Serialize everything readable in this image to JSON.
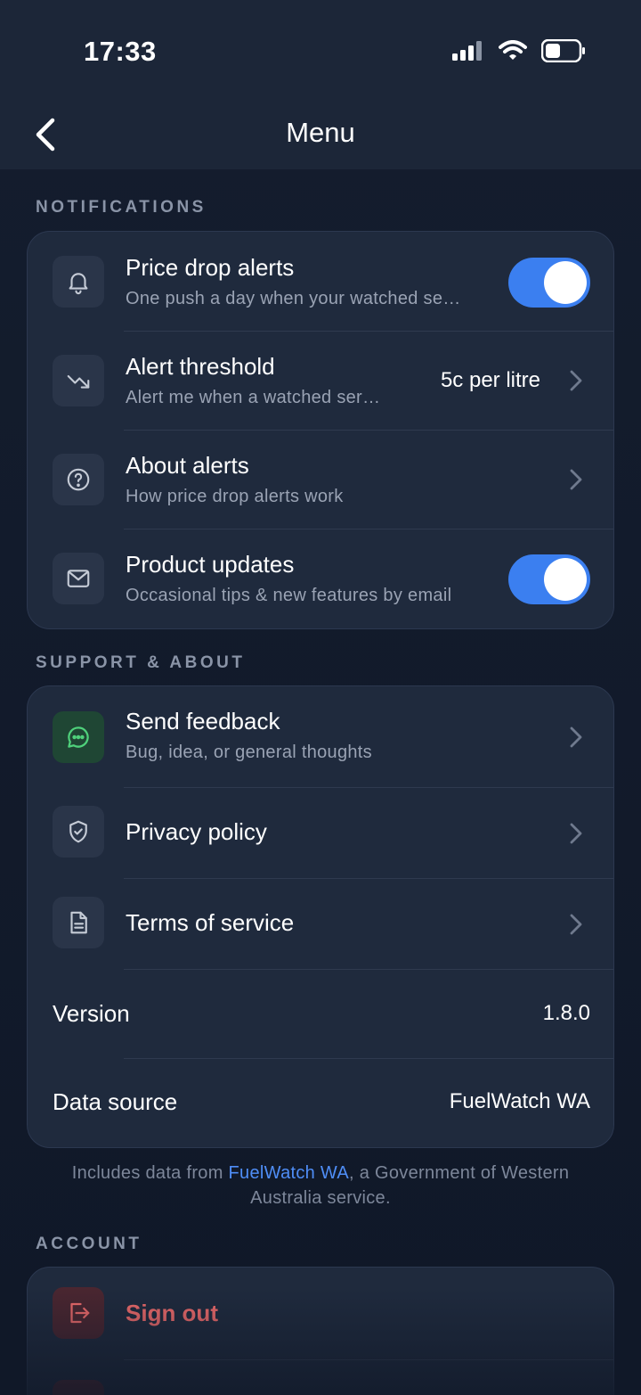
{
  "status_bar": {
    "time": "17:33"
  },
  "nav": {
    "title": "Menu"
  },
  "sections": {
    "notifications": {
      "label": "NOTIFICATIONS",
      "rows": [
        {
          "title": "Price drop alerts",
          "subtitle": "One push a day when your watched se…",
          "toggle": true
        },
        {
          "title": "Alert threshold",
          "subtitle": "Alert me when a watched ser…",
          "value": "5c per litre"
        },
        {
          "title": "About alerts",
          "subtitle": "How price drop alerts work"
        },
        {
          "title": "Product updates",
          "subtitle": "Occasional tips & new features by email",
          "toggle": true
        }
      ]
    },
    "support": {
      "label": "SUPPORT & ABOUT",
      "rows": [
        {
          "title": "Send feedback",
          "subtitle": "Bug, idea, or general thoughts"
        },
        {
          "title": "Privacy policy"
        },
        {
          "title": "Terms of service"
        },
        {
          "title": "Version",
          "value": "1.8.0"
        },
        {
          "title": "Data source",
          "value": "FuelWatch WA"
        }
      ],
      "footnote_prefix": "Includes data from ",
      "footnote_link": "FuelWatch WA",
      "footnote_suffix": ", a Government of Western Australia service."
    },
    "account": {
      "label": "ACCOUNT",
      "rows": [
        {
          "title": "Sign out"
        }
      ]
    }
  },
  "colors": {
    "accent": "#3b7ff0",
    "link": "#4f8ef7",
    "danger": "#f06b6b",
    "card": "#1f2a3d",
    "background": "#111a2b"
  }
}
